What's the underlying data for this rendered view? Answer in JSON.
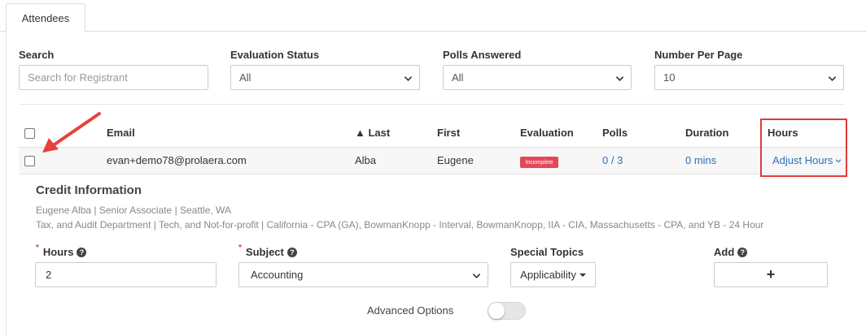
{
  "tabs": [
    {
      "label": "Attendees"
    }
  ],
  "filters": {
    "search": {
      "label": "Search",
      "placeholder": "Search for Registrant"
    },
    "evaluation_status": {
      "label": "Evaluation Status",
      "value": "All"
    },
    "polls_answered": {
      "label": "Polls Answered",
      "value": "All"
    },
    "number_per_page": {
      "label": "Number Per Page",
      "value": "10"
    }
  },
  "table": {
    "columns": [
      "Email",
      "▲ Last",
      "First",
      "Evaluation",
      "Polls",
      "Duration",
      "Hours"
    ],
    "rows": [
      {
        "email": "evan+demo78@prolaera.com",
        "last": "Alba",
        "first": "Eugene",
        "evaluation": "Incomplete",
        "polls": "0 / 3",
        "duration": "0 mins",
        "hours_action": "Adjust Hours"
      }
    ]
  },
  "credit": {
    "title": "Credit Information",
    "line1": "Eugene Alba | Senior Associate | Seattle, WA",
    "line2": "Tax, and Audit Department | Tech, and Not-for-profit | California - CPA (GA), BowmanKnopp - Interval, BowmanKnopp, IIA - CIA, Massachusetts - CPA, and YB - 24 Hour",
    "hours": {
      "label": "Hours",
      "value": "2"
    },
    "subject": {
      "label": "Subject",
      "value": "Accounting"
    },
    "special_topics": {
      "label": "Special Topics",
      "button": "Applicability"
    },
    "add": {
      "label": "Add",
      "button": "+"
    },
    "advanced_options": {
      "label": "Advanced Options",
      "enabled": false
    }
  },
  "colors": {
    "accent_link": "#2e6fb5",
    "badge_incomplete": "#e5475a",
    "highlight_box": "#e23a3a",
    "arrow": "#e8413c"
  },
  "icons": [
    "chevron-down-icon",
    "question-circle-icon",
    "caret-down-icon",
    "plus-icon",
    "red-arrow-annotation"
  ]
}
